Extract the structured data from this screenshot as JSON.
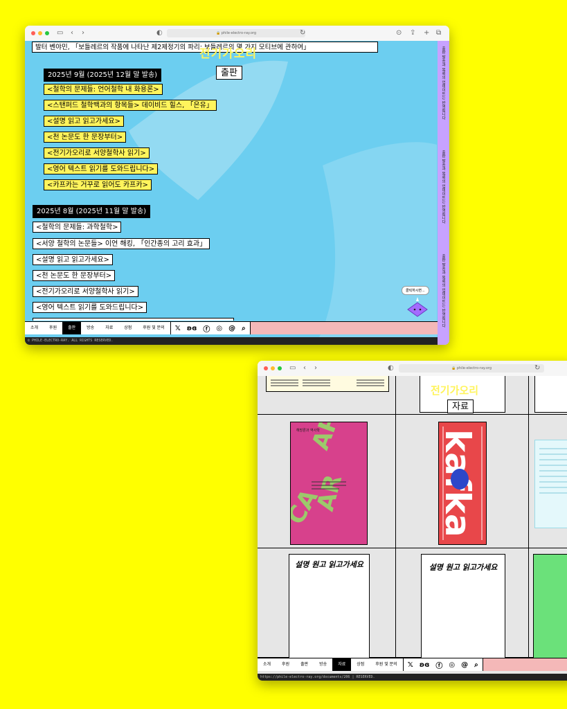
{
  "window1": {
    "url": "🔒 phile-electro-ray.org",
    "top_line": "발터 벤야민, 「보들레르의 작품에 나타난 제2제정기의 파리: 보들레르의 몇 가지 모티브에 관하여」",
    "logo": "전기가오리",
    "page_title": "출판",
    "month1": {
      "heading": "2025년 9월 (2025년 12월 말 발송)",
      "items": [
        "<철학의 문제들: 언어철학 내 화용론>",
        "<스탠퍼드 철학백과의 항목들> 데이비드 힐스, 「은유」",
        "<설명 읽고 읽고가세요>",
        "<천 논문도 한 문장부터>",
        "<전기가오리로 서양철학사 읽기>",
        "<영어 텍스트 읽기를 도와드립니다>",
        "<카프카는 거꾸로 읽어도 카프카>"
      ]
    },
    "month2": {
      "heading": "2025년 8월 (2025년 11월 말 발송)",
      "items": [
        "<철학의 문제들: 과학철학>",
        "<서양 철학의 논문들> 이언 해킹, 「인간종의 고리 효과」",
        "<설명 읽고 읽고가세요>",
        "<천 논문도 한 문장부터>",
        "<전기가오리로 서양철학사 읽기>",
        "<영어 텍스트 읽기를 도와드립니다>"
      ]
    },
    "chat_bubble": "클릭하시면...",
    "side_text": [
      "출판 발송과 목록의 업데이트는 반영됩니다",
      "출판 발송과 목록의 업데이트는 반영됩니다",
      "출판 발송과 목록의 업데이트는 반영됩니다"
    ],
    "nav": [
      "소개",
      "후원",
      "출판",
      "방송",
      "자료",
      "상점",
      "후원 및 문의"
    ],
    "nav_active": "출판",
    "footer": "© PHILE-ELECTRO-RAY. ALL RIGHTS RESERVED."
  },
  "window2": {
    "url": "🔒 phile-electro-ray.org",
    "logo": "전기가오리",
    "page_title": "자료",
    "card_title_1": "설명 원고 읽고가세요",
    "card_title_2": "설명 원고 읽고가세요",
    "book1_lines": [
      "해방론과 역사학",
      "CANAPAR"
    ],
    "book2_text": "kafka",
    "nav": [
      "소개",
      "후원",
      "출판",
      "방송",
      "자료",
      "상점",
      "후원 및 문의"
    ],
    "nav_active": "자료",
    "footer": "https://phile-electro-ray.org/documents/206 | RESERVED."
  },
  "colors": {
    "page_bg": "#FFFF00",
    "sky": "#6CCEF0",
    "entry_yellow": "#FFF45C",
    "side_purple": "#C7A2FF",
    "nav_pink": "#F4B8B8",
    "book_pink": "#D7418C",
    "book_red": "#E8474A",
    "green": "#6BE17A"
  }
}
